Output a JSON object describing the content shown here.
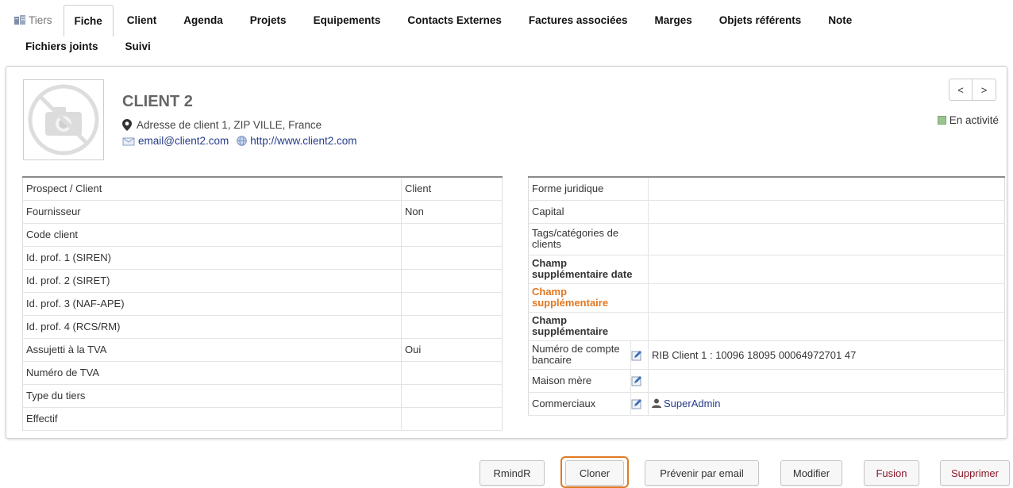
{
  "tabs": {
    "row1": [
      "Tiers",
      "Fiche",
      "Client",
      "Agenda",
      "Projets",
      "Equipements",
      "Contacts Externes",
      "Factures associées",
      "Marges",
      "Objets référents",
      "Note"
    ],
    "row2": [
      "Fichiers joints",
      "Suivi"
    ],
    "active": "Fiche"
  },
  "header": {
    "name": "CLIENT 2",
    "address": "Adresse de client 1, ZIP VILLE, France",
    "email": "email@client2.com",
    "url": "http://www.client2.com",
    "prev_label": "<",
    "next_label": ">",
    "status": "En activité"
  },
  "left_table": [
    {
      "label": "Prospect / Client",
      "value": "Client"
    },
    {
      "label": "Fournisseur",
      "value": "Non"
    },
    {
      "label": "Code client",
      "value": ""
    },
    {
      "label": "Id. prof. 1 (SIREN)",
      "value": ""
    },
    {
      "label": "Id. prof. 2 (SIRET)",
      "value": ""
    },
    {
      "label": "Id. prof. 3 (NAF-APE)",
      "value": ""
    },
    {
      "label": "Id. prof. 4 (RCS/RM)",
      "value": ""
    },
    {
      "label": "Assujetti à la TVA",
      "value": "Oui"
    },
    {
      "label": "Numéro de TVA",
      "value": ""
    },
    {
      "label": "Type du tiers",
      "value": ""
    },
    {
      "label": "Effectif",
      "value": ""
    }
  ],
  "right_table": {
    "forme_juridique": "Forme juridique",
    "capital": "Capital",
    "tags": "Tags/catégories de clients",
    "extra_date": "Champ supplémentaire date",
    "extra_orange": "Champ supplémentaire",
    "extra_plain": "Champ supplémentaire",
    "bank_label": "Numéro de compte bancaire",
    "bank_value": "RIB Client 1 : 10096 18095 00064972701 47",
    "parent_label": "Maison mère",
    "sales_label": "Commerciaux",
    "sales_value": "SuperAdmin"
  },
  "buttons": {
    "rmindr": "RmindR",
    "cloner": "Cloner",
    "email": "Prévenir par email",
    "modify": "Modifier",
    "merge": "Fusion",
    "delete": "Supprimer"
  },
  "colors": {
    "link": "#263c8a",
    "highlight": "#e3771f",
    "status": "#9ac491",
    "danger": "#8a1a2a"
  }
}
